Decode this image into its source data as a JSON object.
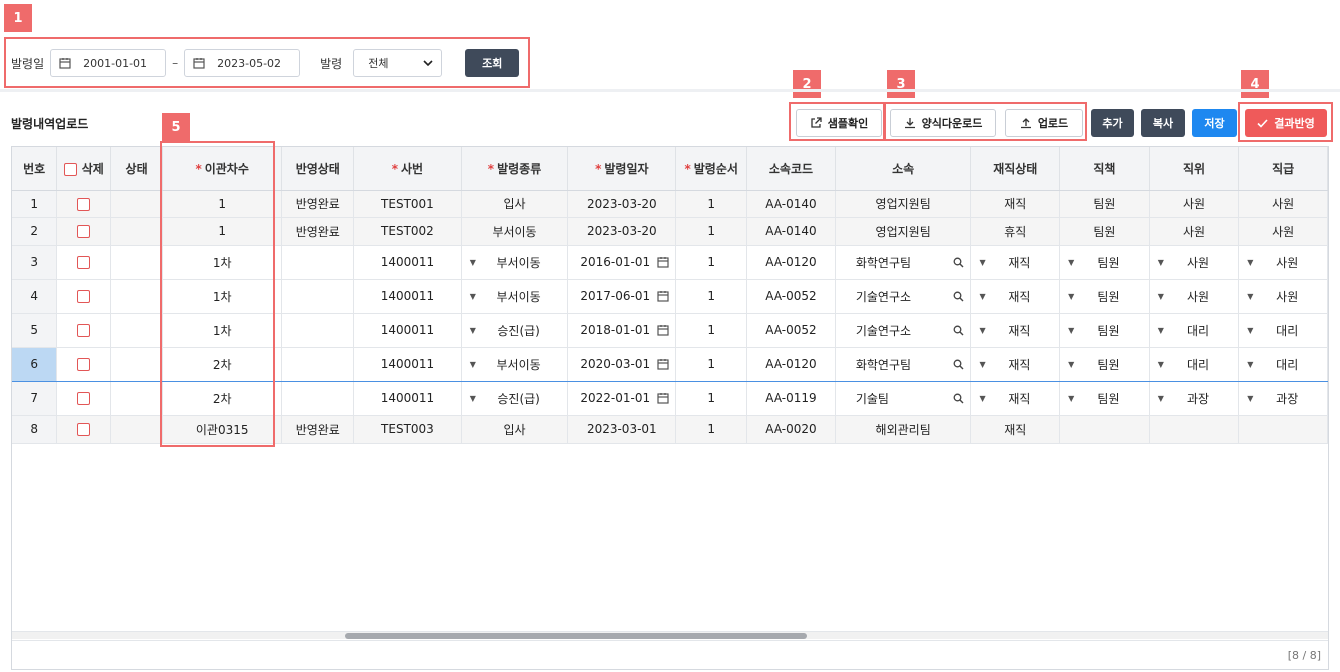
{
  "callouts": [
    "1",
    "2",
    "3",
    "4",
    "5"
  ],
  "search": {
    "label_date": "발령일",
    "start_date": "2001-01-01",
    "dash": "–",
    "end_date": "2023-05-02",
    "label_type": "발령",
    "type_value": "전체",
    "search_button": "조회"
  },
  "toolbar": {
    "title": "발령내역업로드",
    "sample_button": "샘플확인",
    "template_download_button": "양식다운로드",
    "upload_button": "업로드",
    "add_button": "추가",
    "copy_button": "복사",
    "save_button": "저장",
    "apply_button": "결과반영"
  },
  "colors": {
    "accent_red": "#ef6b6b",
    "blue": "#1e88f0",
    "dark": "#3f4a5a",
    "selected": "#bcd8f3"
  },
  "grid": {
    "headers": {
      "no": "번호",
      "delete": "삭제",
      "status": "상태",
      "transfer_seq": "이관차수",
      "apply_status": "반영상태",
      "emp_no": "사번",
      "order_type": "발령종류",
      "order_date": "발령일자",
      "order_seq": "발령순서",
      "dept_code": "소속코드",
      "dept": "소속",
      "emp_status": "재직상태",
      "duty": "직책",
      "position": "직위",
      "grade": "직급"
    },
    "rows": [
      {
        "no": "1",
        "transfer_seq": "1",
        "apply_status": "반영완료",
        "emp_no": "TEST001",
        "order_type": "입사",
        "order_date": "2023-03-20",
        "order_seq": "1",
        "dept_code": "AA-0140",
        "dept": "영업지원팀",
        "emp_status": "재직",
        "duty": "팀원",
        "position": "사원",
        "grade": "사원"
      },
      {
        "no": "2",
        "transfer_seq": "1",
        "apply_status": "반영완료",
        "emp_no": "TEST002",
        "order_type": "부서이동",
        "order_date": "2023-03-20",
        "order_seq": "1",
        "dept_code": "AA-0140",
        "dept": "영업지원팀",
        "emp_status": "휴직",
        "duty": "팀원",
        "position": "사원",
        "grade": "사원"
      },
      {
        "no": "3",
        "transfer_seq": "1차",
        "apply_status": "",
        "emp_no": "1400011",
        "order_type": "부서이동",
        "order_date": "2016-01-01",
        "order_seq": "1",
        "dept_code": "AA-0120",
        "dept": "화학연구팀",
        "emp_status": "재직",
        "duty": "팀원",
        "position": "사원",
        "grade": "사원"
      },
      {
        "no": "4",
        "transfer_seq": "1차",
        "apply_status": "",
        "emp_no": "1400011",
        "order_type": "부서이동",
        "order_date": "2017-06-01",
        "order_seq": "1",
        "dept_code": "AA-0052",
        "dept": "기술연구소",
        "emp_status": "재직",
        "duty": "팀원",
        "position": "사원",
        "grade": "사원"
      },
      {
        "no": "5",
        "transfer_seq": "1차",
        "apply_status": "",
        "emp_no": "1400011",
        "order_type": "승진(급)",
        "order_date": "2018-01-01",
        "order_seq": "1",
        "dept_code": "AA-0052",
        "dept": "기술연구소",
        "emp_status": "재직",
        "duty": "팀원",
        "position": "대리",
        "grade": "대리"
      },
      {
        "no": "6",
        "transfer_seq": "2차",
        "apply_status": "",
        "emp_no": "1400011",
        "order_type": "부서이동",
        "order_date": "2020-03-01",
        "order_seq": "1",
        "dept_code": "AA-0120",
        "dept": "화학연구팀",
        "emp_status": "재직",
        "duty": "팀원",
        "position": "대리",
        "grade": "대리"
      },
      {
        "no": "7",
        "transfer_seq": "2차",
        "apply_status": "",
        "emp_no": "1400011",
        "order_type": "승진(급)",
        "order_date": "2022-01-01",
        "order_seq": "1",
        "dept_code": "AA-0119",
        "dept": "기술팀",
        "emp_status": "재직",
        "duty": "팀원",
        "position": "과장",
        "grade": "과장"
      },
      {
        "no": "8",
        "transfer_seq": "이관0315",
        "apply_status": "반영완료",
        "emp_no": "TEST003",
        "order_type": "입사",
        "order_date": "2023-03-01",
        "order_seq": "1",
        "dept_code": "AA-0020",
        "dept": "해외관리팀",
        "emp_status": "재직",
        "duty": "",
        "position": "",
        "grade": ""
      }
    ],
    "count": "[8 / 8]"
  }
}
